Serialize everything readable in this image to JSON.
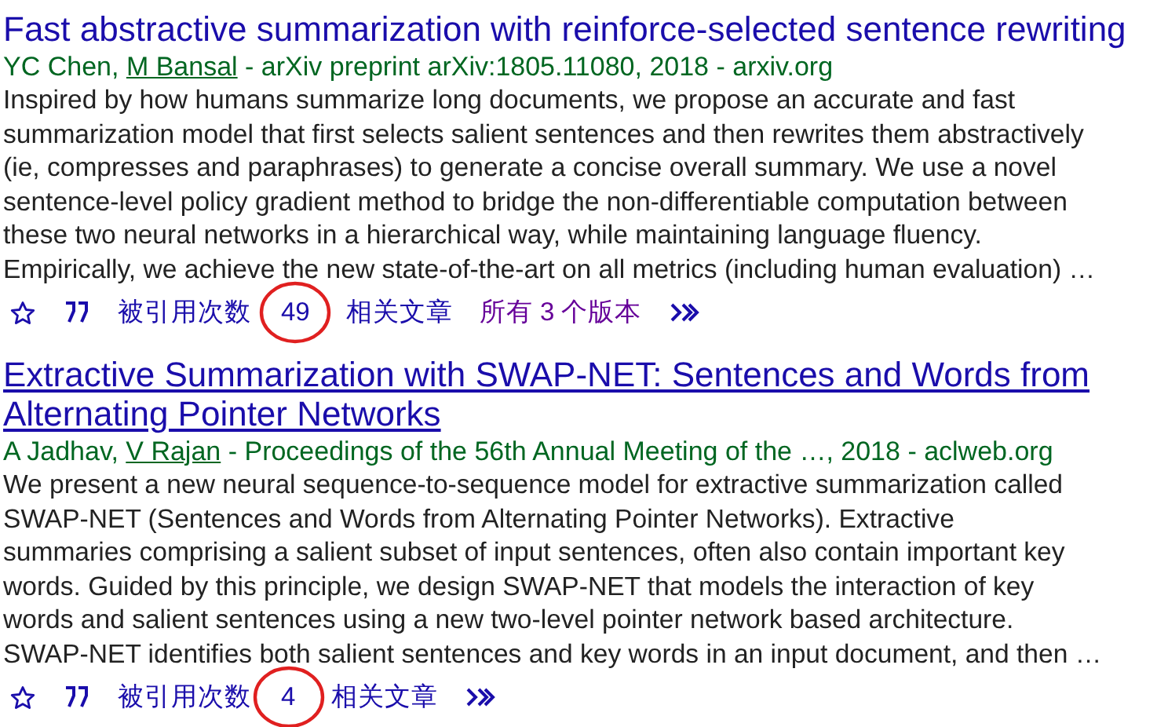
{
  "results": [
    {
      "title_lines": [
        "Fast abstractive summarization with reinforce-selected sentence rewriting"
      ],
      "title_underlined": false,
      "separator": ", ",
      "authors": [
        {
          "name": "YC Chen",
          "linked": false
        },
        {
          "name": "M Bansal",
          "linked": true
        }
      ],
      "source": " - arXiv preprint arXiv:1805.11080, 2018 - arxiv.org",
      "abstract_lines": [
        "Inspired by how humans summarize long documents, we propose an accurate and fast",
        "summarization model that first selects salient sentences and then rewrites them abstractively",
        "(ie, compresses and paraphrases) to generate a concise overall summary. We use a novel",
        "sentence-level policy gradient method to bridge the non-differentiable computation between",
        "these two neural networks in a hierarchical way, while maintaining language fluency.",
        "Empirically, we achieve the new state-of-the-art on all metrics (including human evaluation) …"
      ],
      "cited_label": "被引用次数",
      "cited_count": "49",
      "circled": true,
      "related": "相关文章",
      "versions": "所有 3 个版本"
    },
    {
      "title_lines": [
        "Extractive Summarization with SWAP-NET: Sentences and Words from",
        "Alternating Pointer Networks"
      ],
      "title_underlined": true,
      "separator": ", ",
      "authors": [
        {
          "name": "A Jadhav",
          "linked": false
        },
        {
          "name": "V Rajan",
          "linked": true
        }
      ],
      "source": " - Proceedings of the 56th Annual Meeting of the …, 2018 - aclweb.org",
      "abstract_lines": [
        "We present a new neural sequence-to-sequence model for extractive summarization called",
        "SWAP-NET (Sentences and Words from Alternating Pointer Networks). Extractive",
        "summaries comprising a salient subset of input sentences, often also contain important key",
        "words. Guided by this principle, we design SWAP-NET that models the interaction of key",
        "words and salient sentences using a new two-level pointer network based architecture.",
        "SWAP-NET identifies both salient sentences and key words in an input document, and then …"
      ],
      "cited_label": "被引用次数",
      "cited_count": "4",
      "circled": true,
      "related": "相关文章"
    }
  ]
}
